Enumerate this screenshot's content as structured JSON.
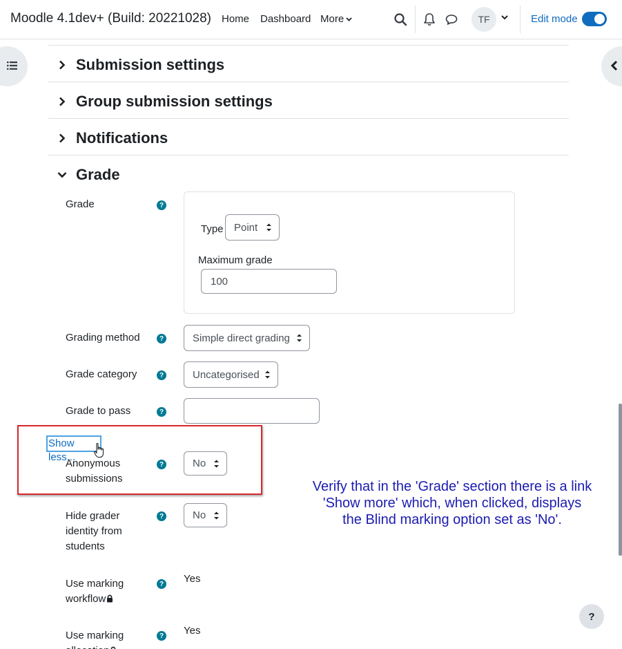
{
  "navbar": {
    "brand": "Moodle 4.1dev+ (Build: 20221028)",
    "links": [
      "Home",
      "Dashboard",
      "More"
    ],
    "avatar_initials": "TF",
    "edit_mode_label": "Edit mode",
    "edit_mode_on": true
  },
  "sections": {
    "submission": "Submission settings",
    "group": "Group submission settings",
    "notifications": "Notifications",
    "grade": "Grade"
  },
  "grade_form": {
    "grade_label": "Grade",
    "type_label": "Type",
    "type_value": "Point",
    "max_grade_label": "Maximum grade",
    "max_grade_value": "100",
    "grading_method_label": "Grading method",
    "grading_method_value": "Simple direct grading",
    "grade_category_label": "Grade category",
    "grade_category_value": "Uncategorised",
    "grade_to_pass_label": "Grade to pass",
    "grade_to_pass_value": "",
    "show_less_label": "Show less...",
    "anonymous_label_1": "Anonymous",
    "anonymous_label_2": "submissions",
    "anonymous_value": "No",
    "hide_grader_label_1": "Hide grader",
    "hide_grader_label_2": "identity from",
    "hide_grader_label_3": "students",
    "hide_grader_value": "No",
    "workflow_label_1": "Use marking",
    "workflow_label_2": "workflow",
    "workflow_value": "Yes",
    "allocation_label_1": "Use marking",
    "allocation_label_2": "allocation",
    "allocation_value": "Yes"
  },
  "annotation": {
    "line1": "Verify that in the 'Grade' section there is a link",
    "line2": "'Show more' which, when clicked, displays",
    "line3": "the Blind marking option set as 'No'."
  },
  "help_button": "?",
  "colors": {
    "primary": "#0f6cbf",
    "help_icon": "#007a94",
    "highlight_box": "#d9262c",
    "annotation_text": "#1b1bb0"
  }
}
